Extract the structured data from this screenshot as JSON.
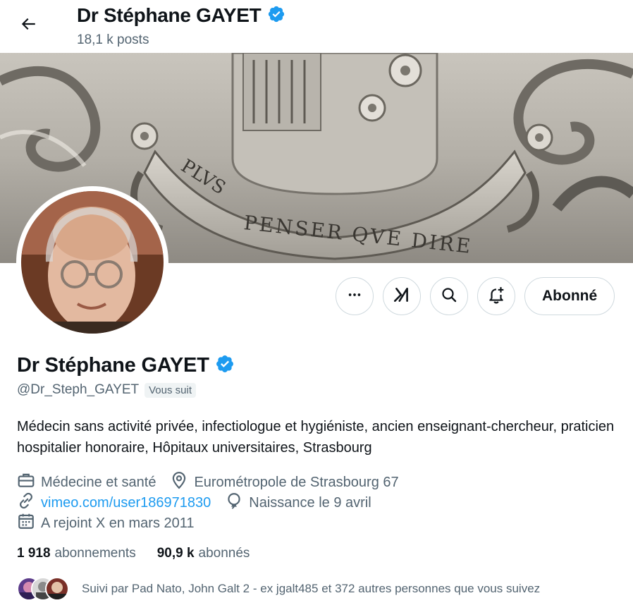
{
  "header": {
    "back_label": "Back",
    "name": "Dr Stéphane GAYET",
    "posts_count": "18,1 k posts"
  },
  "banner": {
    "motto_line1": "PLVS",
    "motto_line2": "PENSER QVE DIRE"
  },
  "actions": {
    "more_label": "More",
    "grok_label": "Grok",
    "search_label": "Search",
    "notify_label": "Notifications",
    "follow_label": "Abonné"
  },
  "profile": {
    "name": "Dr Stéphane GAYET",
    "handle": "@Dr_Steph_GAYET",
    "follows_you": "Vous suit",
    "bio": "Médecin sans activité privée, infectiologue et hygiéniste, ancien enseignant-chercheur, praticien hospitalier honoraire, Hôpitaux universitaires, Strasbourg",
    "category": "Médecine et santé",
    "location": "Eurométropole de Strasbourg 67",
    "website": "vimeo.com/user186971830",
    "birthday": "Naissance le 9 avril",
    "joined": "A rejoint X en mars 2011"
  },
  "stats": {
    "following_count": "1 918",
    "following_label": "abonnements",
    "followers_count": "90,9 k",
    "followers_label": "abonnés"
  },
  "followed_by": {
    "text": "Suivi par Pad Nato, John Galt 2 - ex jgalt485 et 372 autres personnes que vous suivez"
  },
  "colors": {
    "accent": "#1d9bf0",
    "verified": "#1d9bf0",
    "secondary_text": "#536471",
    "border": "#cfd9de"
  },
  "icons": {
    "back": "arrow-left-icon",
    "verified": "verified-badge-icon",
    "more": "more-dots-icon",
    "grok": "grok-icon",
    "search": "search-icon",
    "notify": "bell-plus-icon",
    "category": "briefcase-icon",
    "location": "location-pin-icon",
    "website": "link-icon",
    "birthday": "balloon-icon",
    "joined": "calendar-icon"
  }
}
